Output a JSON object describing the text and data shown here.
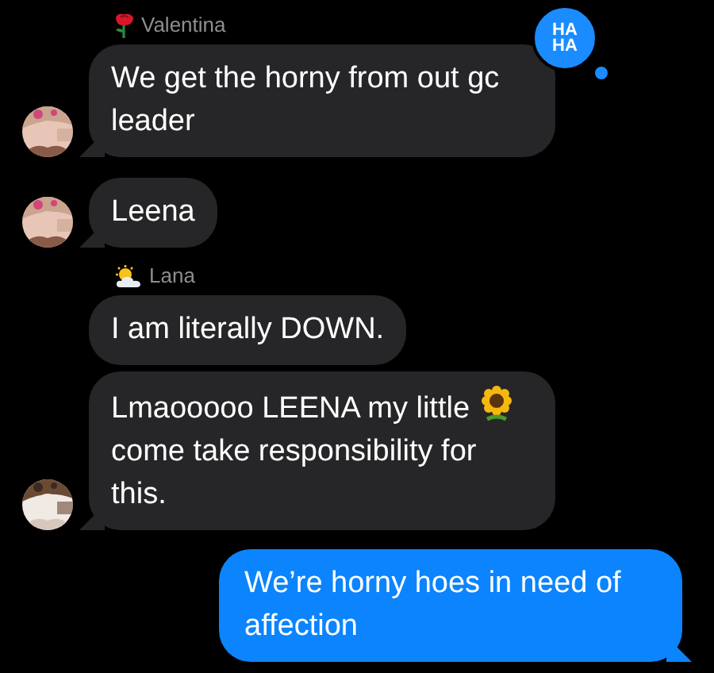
{
  "messages": [
    {
      "kind": "sender",
      "name": "Valentina"
    },
    {
      "kind": "incoming",
      "avatar": true,
      "parts": [
        "We get the horny from out gc leader"
      ],
      "reaction": "HA HA"
    },
    {
      "kind": "incoming",
      "avatar": true,
      "parts": [
        "Leena"
      ]
    },
    {
      "kind": "sender",
      "name": "Lana"
    },
    {
      "kind": "incoming",
      "avatar": false,
      "parts": [
        "I am literally DOWN."
      ]
    },
    {
      "kind": "incoming",
      "avatar": true,
      "parts": [
        "Lmaooooo LEENA my little",
        "come take responsibility for this."
      ]
    },
    {
      "kind": "outgoing",
      "parts": [
        "We’re horny hoes in need of affection"
      ]
    }
  ]
}
